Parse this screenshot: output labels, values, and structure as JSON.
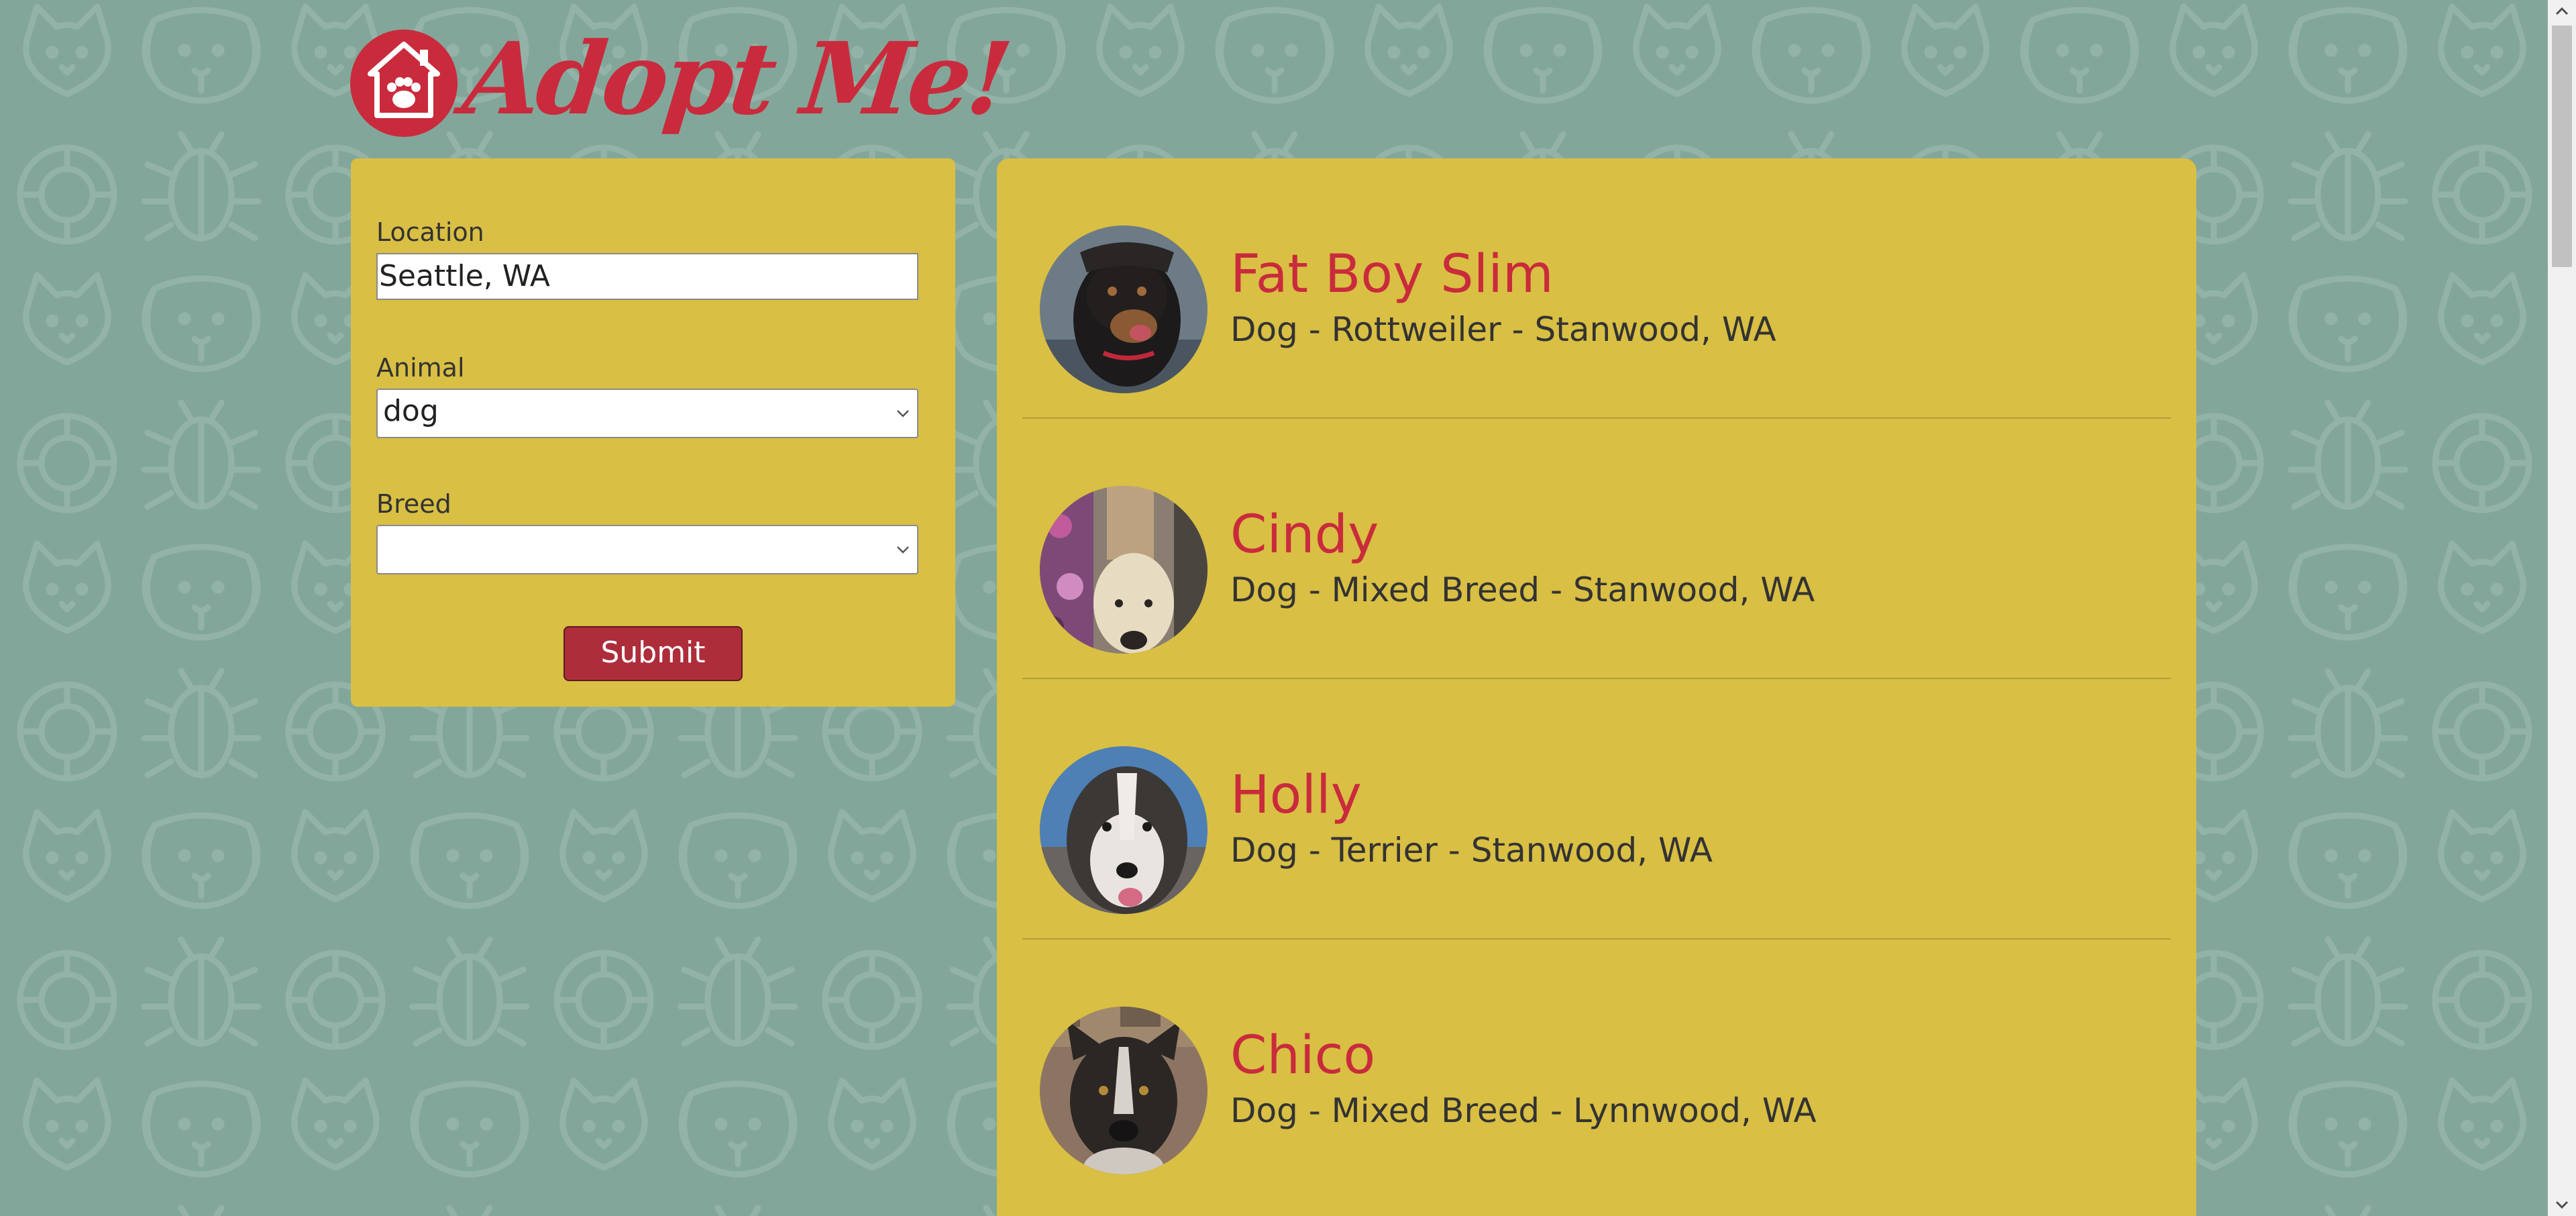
{
  "app": {
    "logo_text": "Adopt Me!",
    "logo_icon": "house-paw-icon"
  },
  "search": {
    "location_label": "Location",
    "location_value": "Seattle, WA",
    "animal_label": "Animal",
    "animal_value": "dog",
    "breed_label": "Breed",
    "breed_value": "",
    "submit_label": "Submit"
  },
  "results": [
    {
      "name": "Fat Boy Slim",
      "info": "Dog - Rottweiler - Stanwood, WA"
    },
    {
      "name": "Cindy",
      "info": "Dog - Mixed Breed - Stanwood, WA"
    },
    {
      "name": "Holly",
      "info": "Dog - Terrier - Stanwood, WA"
    },
    {
      "name": "Chico",
      "info": "Dog - Mixed Breed - Lynnwood, WA"
    }
  ],
  "colors": {
    "background": "#83a69b",
    "panel": "#d9bf43",
    "accent_red": "#c92b3c",
    "button": "#ad2d3b"
  }
}
